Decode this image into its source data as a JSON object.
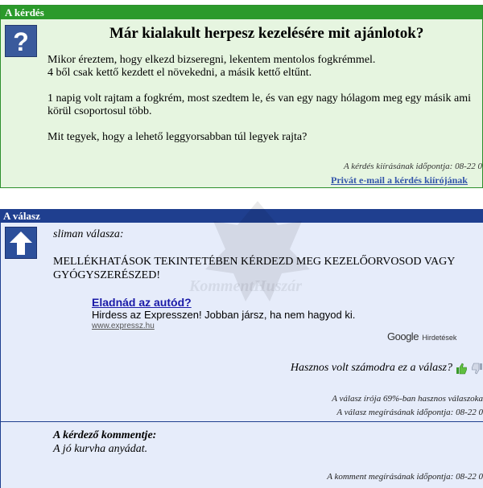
{
  "question": {
    "header": "A kérdés",
    "icon": "question-mark-icon",
    "title": "Már kialakult herpesz kezelésére mit ajánlotok?",
    "paragraphs": [
      "Mikor éreztem, hogy elkezd bizseregni, lekentem mentolos fogkrémmel.",
      "4 ből csak kettő kezdett el növekedni, a másik kettő eltűnt.",
      "1 napig volt rajtam a fogkrém, most szedtem le, és van egy nagy hólagom meg egy másik ami körül csoportosul több.",
      "Mit tegyek, hogy a lehető leggyorsabban túl legyek rajta?"
    ],
    "meta": "A kérdés kiírásának időpontja: 08-22 0",
    "private_link": "Privát e-mail a kérdés kiírójának"
  },
  "answer": {
    "header": "A válasz",
    "icon": "up-arrow-icon",
    "author": "sliman válasza:",
    "text": "MELLÉKHATÁSOK TEKINTETÉBEN KÉRDEZD MEG KEZELŐORVOSOD VAGY GYÓGYSZERÉSZED!",
    "ad": {
      "title": "Eladnád az autód?",
      "description": "Hirdess az Expresszen! Jobban jársz, ha nem hagyod ki.",
      "url": "www.expressz.hu"
    },
    "google_logo": "Google",
    "google_label": "Hirdetések",
    "useful_question": "Hasznos volt számodra ez a válasz?",
    "meta_useful": "A válasz írója 69%-ban hasznos válaszoka",
    "meta_time": "A válasz megírásának időpontja: 08-22 0",
    "comment_label": "A kérdező kommentje:",
    "comment_text": "A jó kurvha anyádat.",
    "comment_meta": "A komment megírásának időpontja: 08-22 0"
  },
  "watermark": "KommentHuszár",
  "colors": {
    "question_header": "#2b9a2b",
    "question_bg": "#e6f5e0",
    "answer_header": "#1f3f8f",
    "answer_bg": "#e6ecfa",
    "link": "#3355aa",
    "ad_title": "#1a1aa8"
  }
}
